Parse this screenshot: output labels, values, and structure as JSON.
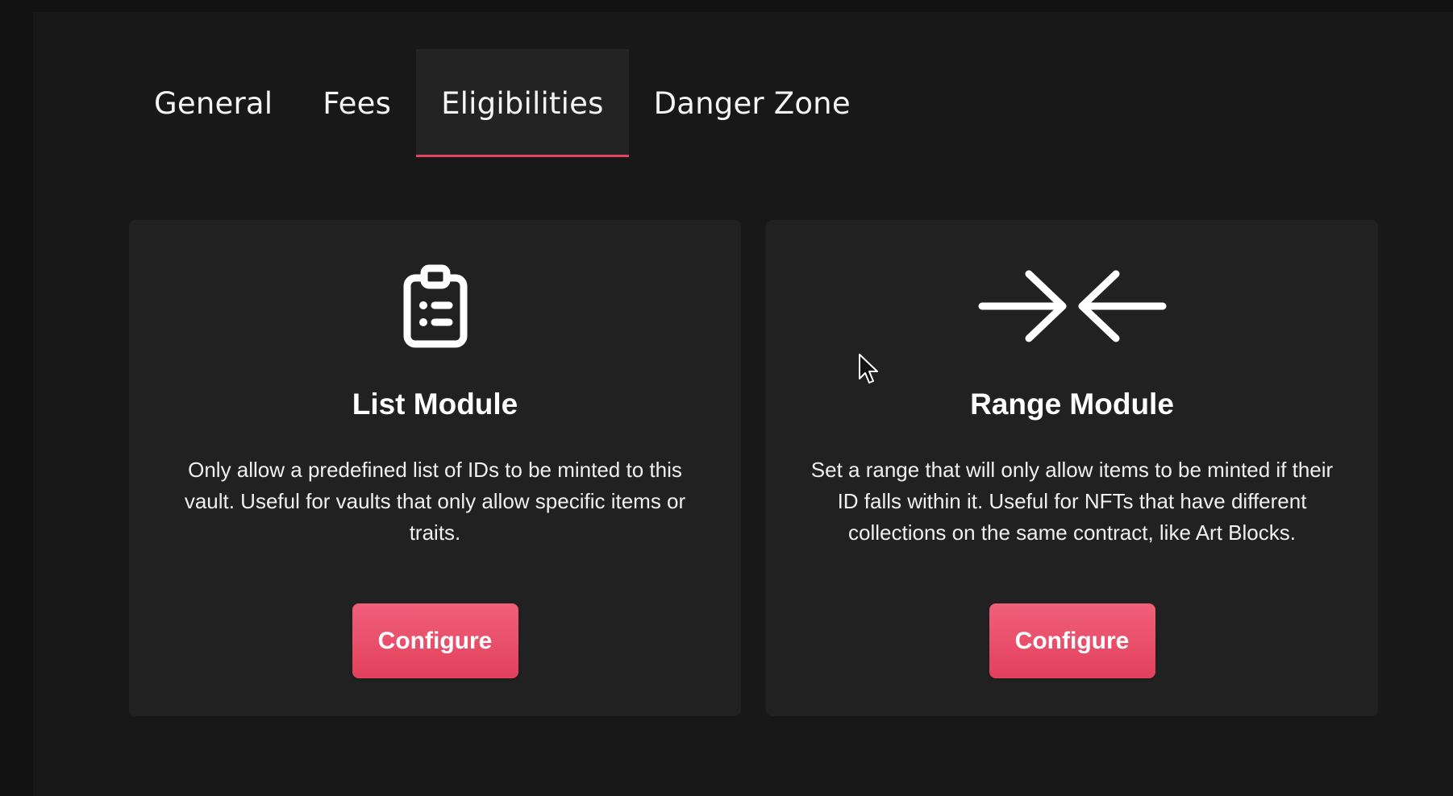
{
  "tabs": [
    {
      "label": "General",
      "active": false
    },
    {
      "label": "Fees",
      "active": false
    },
    {
      "label": "Eligibilities",
      "active": true
    },
    {
      "label": "Danger Zone",
      "active": false
    }
  ],
  "colors": {
    "accent": "#e2455f",
    "page_bg": "#121212",
    "panel_bg": "#181818",
    "card_bg": "#212121"
  },
  "modules": [
    {
      "icon": "clipboard-list-icon",
      "title": "List Module",
      "description": "Only allow a predefined list of IDs to be minted to this vault. Useful for vaults that only allow specific items or traits.",
      "button_label": "Configure"
    },
    {
      "icon": "arrows-converge-icon",
      "title": "Range Module",
      "description": "Set a range that will only allow items to be minted if their ID falls within it. Useful for NFTs that have different collections on the same contract, like Art Blocks.",
      "button_label": "Configure"
    }
  ]
}
